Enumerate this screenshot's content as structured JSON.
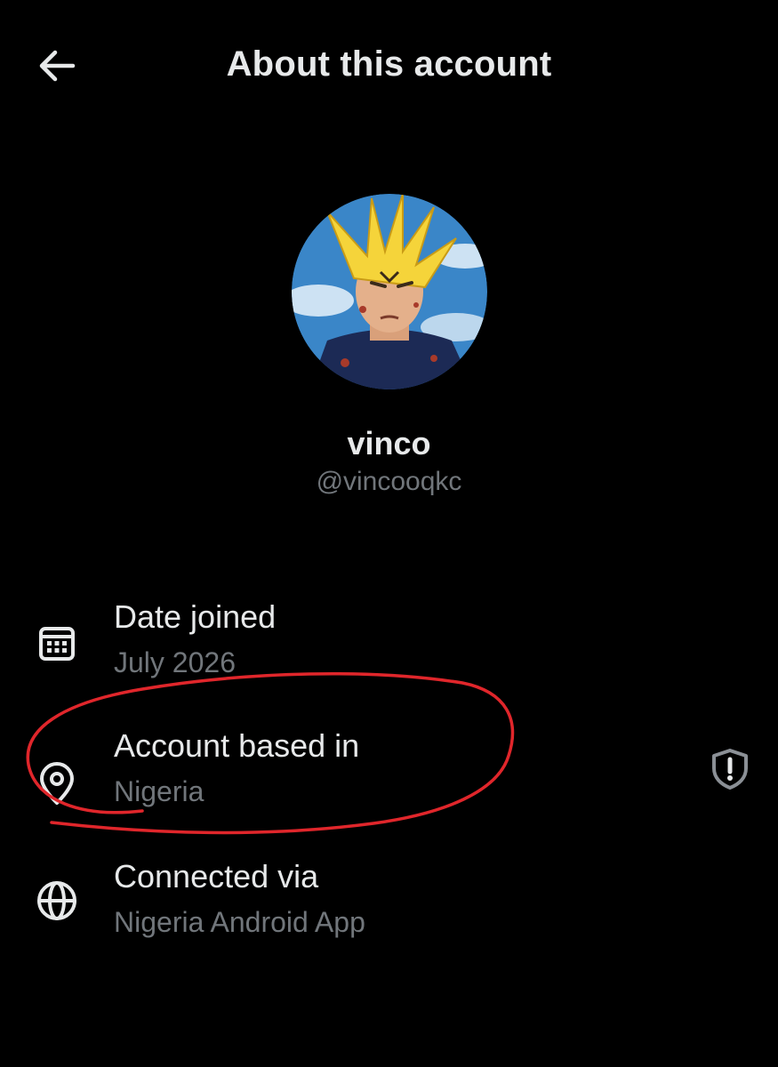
{
  "header": {
    "title": "About this account",
    "back_icon": "arrow-left-icon"
  },
  "profile": {
    "display_name": "vinco",
    "handle": "@vincooqkc",
    "avatar_icon": "avatar"
  },
  "info_rows": [
    {
      "icon": "calendar-icon",
      "label": "Date joined",
      "value": "July 2026"
    },
    {
      "icon": "location-pin-icon",
      "label": "Account based in",
      "value": "Nigeria",
      "trailing_icon": "shield-alert-icon"
    },
    {
      "icon": "globe-icon",
      "label": "Connected via",
      "value": "Nigeria Android App"
    }
  ],
  "colors": {
    "background": "#000000",
    "primary_text": "#e7e9ea",
    "secondary_text": "#71767b",
    "annotation": "#e0262b"
  }
}
